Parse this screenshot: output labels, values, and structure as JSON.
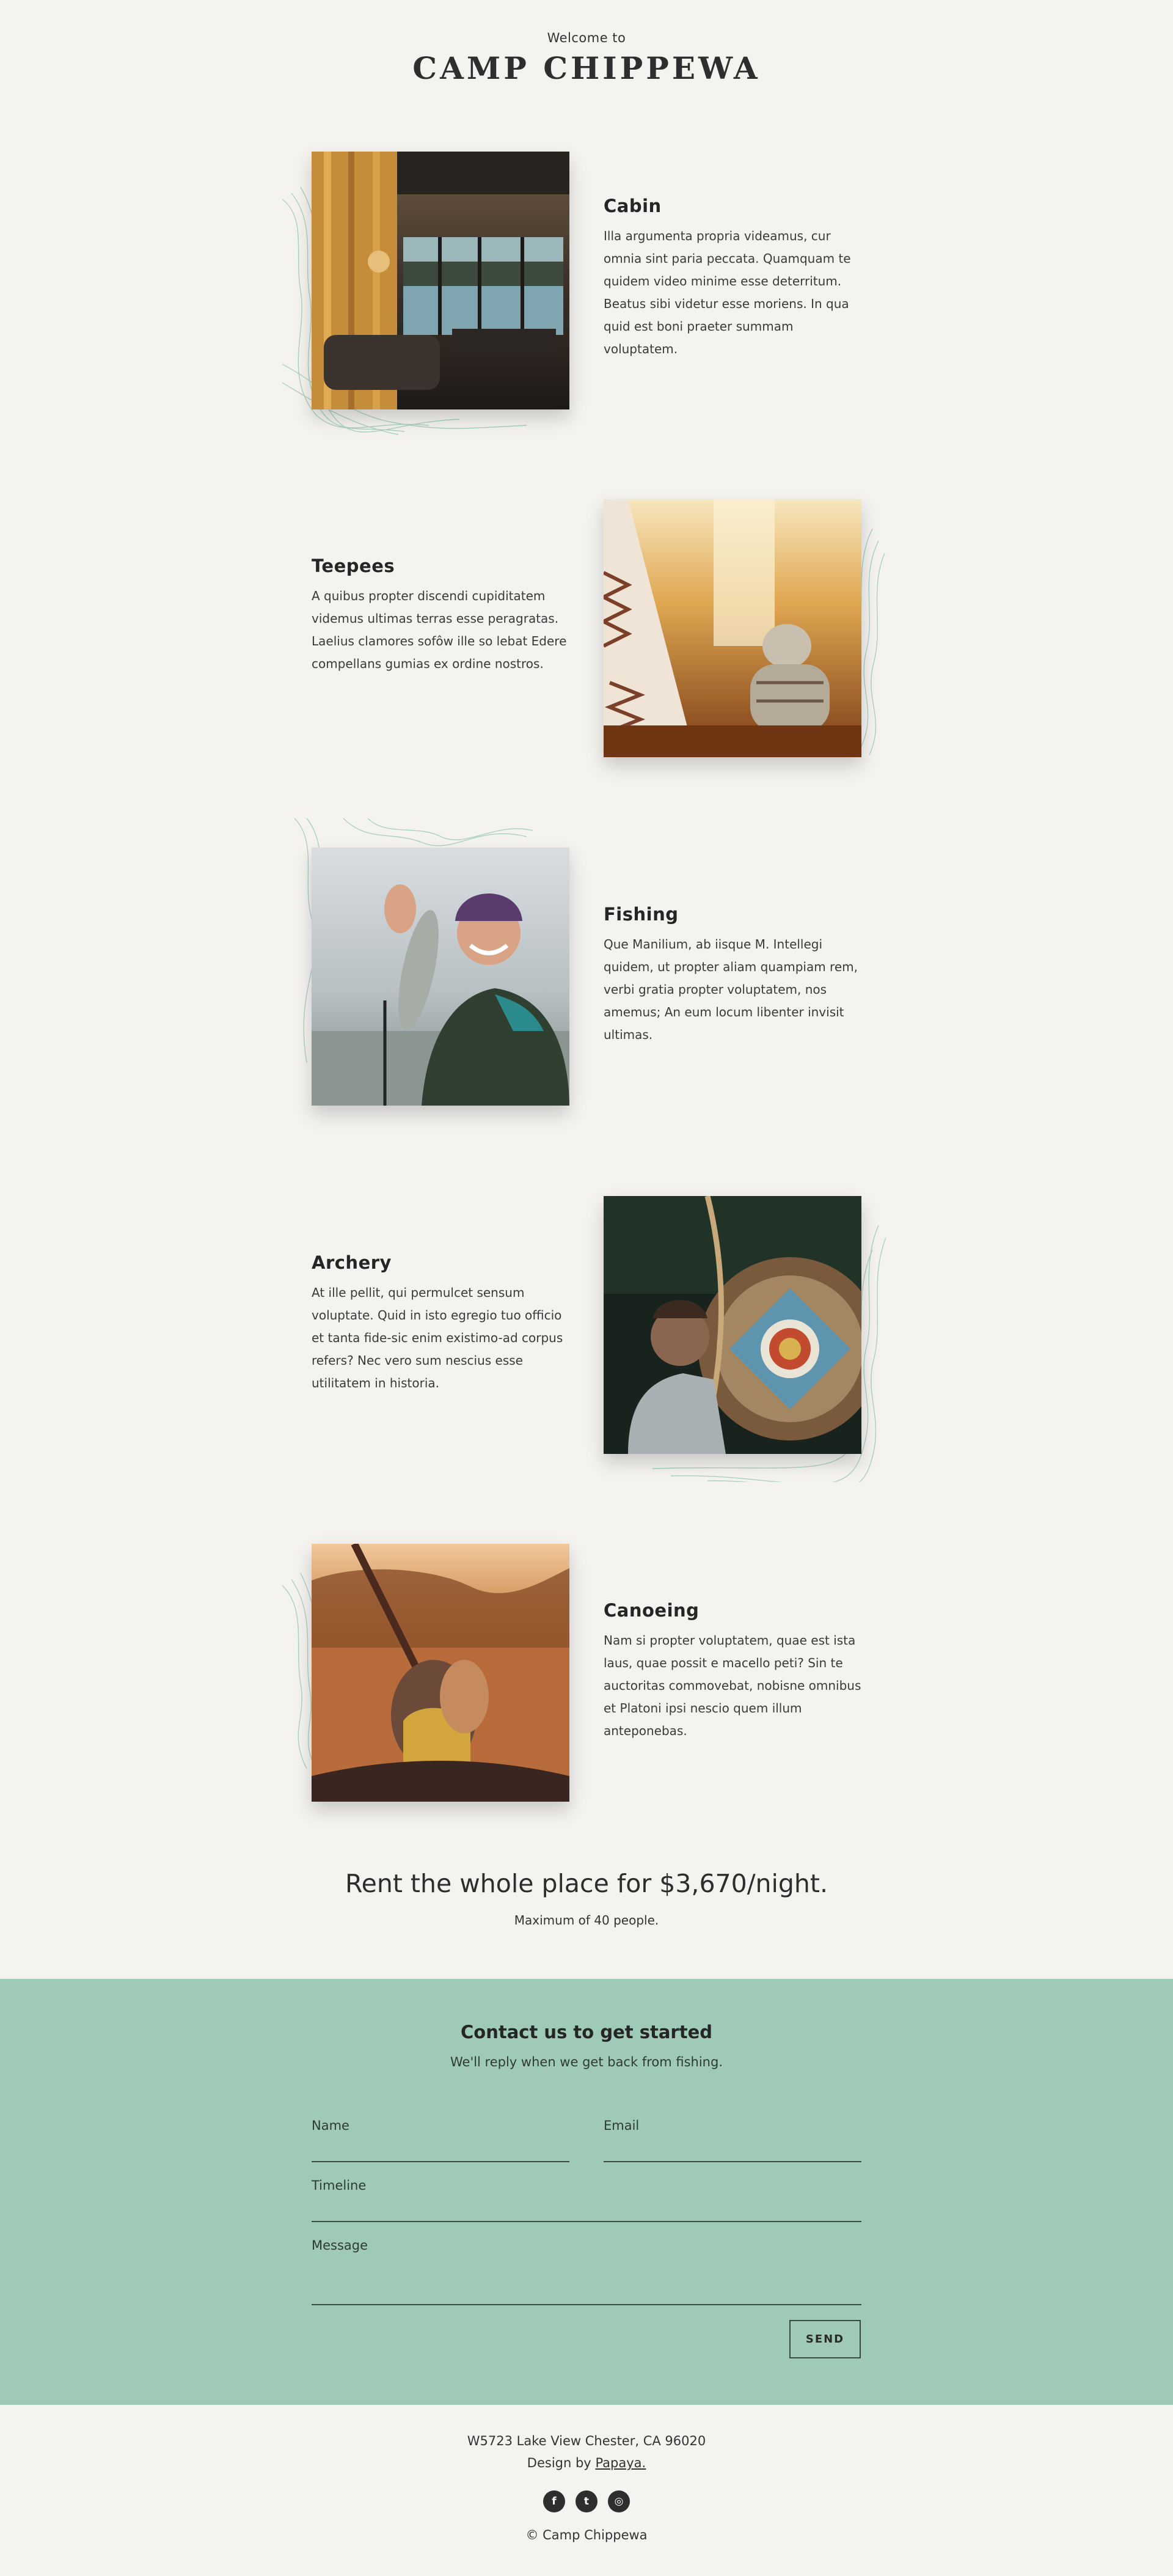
{
  "header": {
    "welcome": "Welcome to",
    "brand": "CAMP CHIPPEWA"
  },
  "sections": [
    {
      "title": "Cabin",
      "body": "Illa argumenta propria videamus, cur omnia sint paria peccata. Quamquam te quidem video minime esse deterritum. Beatus sibi videtur esse moriens. In qua quid est boni praeter summam voluptatem.",
      "image": "cabin-interior-photo"
    },
    {
      "title": "Teepees",
      "body": "A quibus propter discendi cupiditatem videmus ultimas terras esse peragratas. Laelius clamores sofôw ille so lebat Edere compellans gumias ex ordine nostros.",
      "image": "teepee-photo"
    },
    {
      "title": "Fishing",
      "body": "Que Manilium, ab iisque M. Intellegi quidem, ut propter aliam quampiam rem, verbi gratia propter voluptatem, nos amemus; An eum locum libenter invisit ultimas.",
      "image": "fishing-photo"
    },
    {
      "title": "Archery",
      "body": "At ille pellit, qui permulcet sensum voluptate. Quid in isto egregio tuo officio et tanta fide-sic enim existimo-ad corpus refers? Nec vero sum nescius esse utilitatem in historia.",
      "image": "archery-photo"
    },
    {
      "title": "Canoeing",
      "body": "Nam si propter voluptatem, quae est ista laus, quae possit e macello peti? Sin te auctoritas commovebat, nobisne omnibus et Platoni ipsi nescio quem illum anteponebas.",
      "image": "canoeing-photo"
    }
  ],
  "rent": {
    "headline": "Rent the whole place for $3,670/night.",
    "note": "Maximum of 40 people."
  },
  "contact": {
    "title": "Contact us to get started",
    "subtitle": "We'll reply when we get back from fishing.",
    "name_label": "Name",
    "email_label": "Email",
    "timeline_label": "Timeline",
    "message_label": "Message",
    "send_label": "SEND"
  },
  "footer": {
    "address": "W5723 Lake View Chester, CA 96020",
    "design_prefix": "Design by",
    "design_link": "Papaya.",
    "copyright": "© Camp Chippewa",
    "social": [
      {
        "icon": "facebook-icon",
        "glyph": "f"
      },
      {
        "icon": "twitter-icon",
        "glyph": "t"
      },
      {
        "icon": "instagram-icon",
        "glyph": "◎"
      }
    ]
  }
}
